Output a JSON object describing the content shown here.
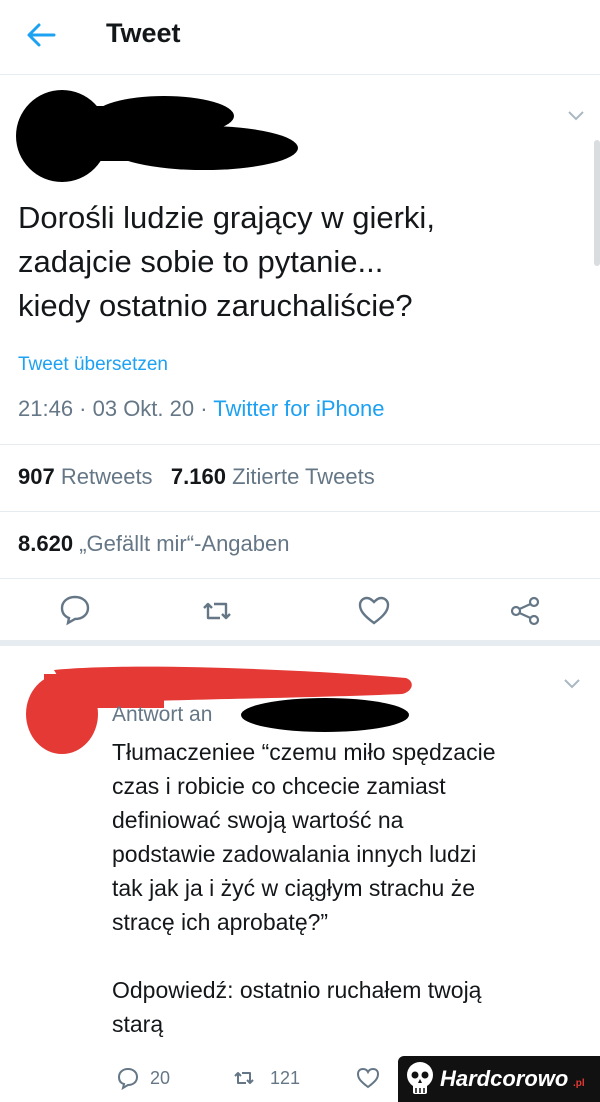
{
  "header": {
    "title": "Tweet"
  },
  "tweet": {
    "lines": [
      "Dorośli ludzie grający w gierki,",
      "zadajcie sobie to pytanie...",
      "kiedy ostatnio zaruchaliście?"
    ],
    "translate_label": "Tweet übersetzen",
    "time": "21:46 · 03 Okt. 20 · ",
    "source": "Twitter for iPhone",
    "retweets_count": "907",
    "retweets_label": "Retweets",
    "quotes_count": "7.160",
    "quotes_label": "Zitierte Tweets",
    "likes_count": "8.620",
    "likes_label": "„Gefällt mir“-Angaben"
  },
  "reply": {
    "reply_to_label": "Antwort an",
    "lines": [
      "Tłumaczeniee “czemu miło spędzacie",
      "czas i robicie co chcecie zamiast",
      "definiować swoją wartość na",
      "podstawie zadowalania innych ludzi",
      "tak jak ja i żyć w ciągłym strachu że",
      "stracę ich aprobatę?”",
      "",
      "Odpowiedź: ostatnio ruchałem twoją",
      "starą"
    ],
    "reply_count": "20",
    "retweet_count": "121"
  },
  "watermark": {
    "text": "Hardcorowo",
    "suffix": ".pl"
  },
  "colors": {
    "accent": "#1da1f2",
    "secondary_text": "#657786",
    "redaction_red": "#e53935"
  }
}
